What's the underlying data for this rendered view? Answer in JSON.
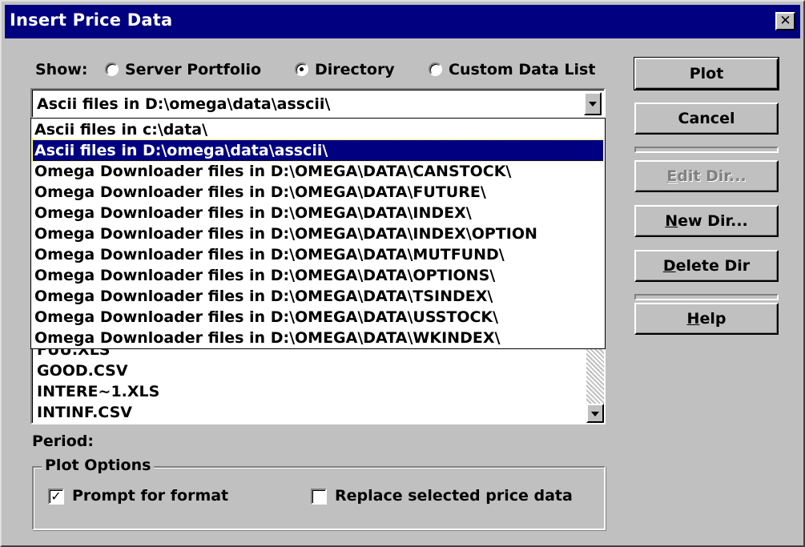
{
  "window": {
    "title": "Insert Price Data",
    "close_glyph": "✕"
  },
  "show": {
    "label": "Show:",
    "options": [
      {
        "label": "Server Portfolio",
        "selected": false
      },
      {
        "label": "Directory",
        "selected": true
      },
      {
        "label": "Custom Data List",
        "selected": false
      }
    ]
  },
  "combo": {
    "value": "Ascii files in D:\\omega\\data\\asscii\\"
  },
  "dropdown": {
    "items": [
      "Ascii files in c:\\data\\",
      "Ascii files in D:\\omega\\data\\asscii\\",
      "Omega Downloader files in D:\\OMEGA\\DATA\\CANSTOCK\\",
      "Omega Downloader files in D:\\OMEGA\\DATA\\FUTURE\\",
      "Omega Downloader files in D:\\OMEGA\\DATA\\INDEX\\",
      "Omega Downloader files in D:\\OMEGA\\DATA\\INDEX\\OPTION",
      "Omega Downloader files in D:\\OMEGA\\DATA\\MUTFUND\\",
      "Omega Downloader files in D:\\OMEGA\\DATA\\OPTIONS\\",
      "Omega Downloader files in D:\\OMEGA\\DATA\\TSINDEX\\",
      "Omega Downloader files in D:\\OMEGA\\DATA\\USSTOCK\\",
      "Omega Downloader files in D:\\OMEGA\\DATA\\WKINDEX\\"
    ],
    "selected_index": 1
  },
  "files": {
    "items": [
      "FUU.XLS",
      "GOOD.CSV",
      "INTERE~1.XLS",
      "INTINF.CSV"
    ]
  },
  "period": {
    "label": "Period:"
  },
  "buttons": {
    "plot": "Plot",
    "cancel": "Cancel",
    "edit_dir": {
      "mnemonic": "E",
      "rest": "dit Dir..."
    },
    "new_dir": {
      "mnemonic": "N",
      "rest": "ew Dir..."
    },
    "delete_dir": {
      "mnemonic": "D",
      "rest": "elete Dir"
    },
    "help": {
      "mnemonic": "H",
      "rest": "elp"
    }
  },
  "plot_options": {
    "legend": "Plot Options",
    "prompt_for_format": {
      "label": "Prompt for format",
      "checked": true
    },
    "replace_selected": {
      "label": "Replace selected price data",
      "checked": false
    }
  }
}
